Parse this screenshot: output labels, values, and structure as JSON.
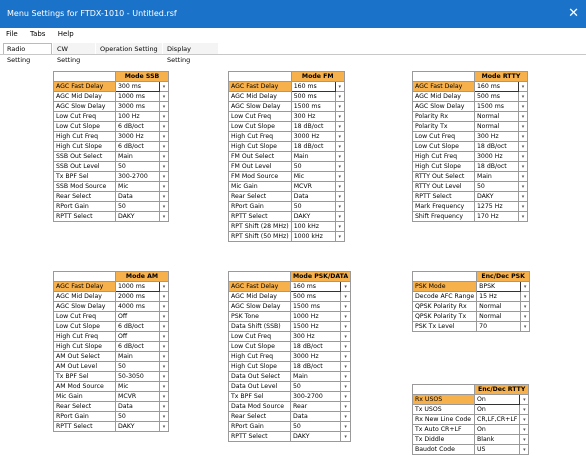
{
  "window": {
    "title": "Menu Settings for FTDX-1010 - Untitled.rsf",
    "close": "✕"
  },
  "menu": [
    "File",
    "Tabs",
    "Help"
  ],
  "tabs": [
    "Radio Setting",
    "CW Setting",
    "Operation Setting",
    "Display Setting"
  ],
  "panels": [
    {
      "id": "ssb",
      "header": "Mode SSB",
      "rows": [
        [
          "AGC Fast Delay",
          "300 ms"
        ],
        [
          "AGC Mid Delay",
          "1000 ms"
        ],
        [
          "AGC Slow Delay",
          "3000 ms"
        ],
        [
          "Low Cut Freq",
          "100 Hz"
        ],
        [
          "Low Cut Slope",
          "6 dB/oct"
        ],
        [
          "High Cut Freq",
          "3000 Hz"
        ],
        [
          "High Cut Slope",
          "6 dB/oct"
        ],
        [
          "SSB Out Select",
          "Main"
        ],
        [
          "SSB Out Level",
          "50"
        ],
        [
          "Tx BPF Sel",
          "300-2700"
        ],
        [
          "SSB Mod Source",
          "Mic"
        ],
        [
          "Rear Select",
          "Data"
        ],
        [
          "RPort Gain",
          "50"
        ],
        [
          "RPTT Select",
          "DAKY"
        ]
      ]
    },
    {
      "id": "fm",
      "header": "Mode FM",
      "rows": [
        [
          "AGC Fast Delay",
          "160 ms"
        ],
        [
          "AGC Mid Delay",
          "500 ms"
        ],
        [
          "AGC Slow Delay",
          "1500 ms"
        ],
        [
          "Low Cut Freq",
          "300 Hz"
        ],
        [
          "Low Cut Slope",
          "18 dB/oct"
        ],
        [
          "High Cut Freq",
          "3000 Hz"
        ],
        [
          "High Cut Slope",
          "18 dB/oct"
        ],
        [
          "FM Out Select",
          "Main"
        ],
        [
          "FM Out Level",
          "50"
        ],
        [
          "FM Mod Source",
          "Mic"
        ],
        [
          "Mic Gain",
          "MCVR"
        ],
        [
          "Rear Select",
          "Data"
        ],
        [
          "RPort Gain",
          "50"
        ],
        [
          "RPTT Select",
          "DAKY"
        ],
        [
          "RPT Shift (28 MHz)",
          "100 kHz"
        ],
        [
          "RPT Shift (50 MHz)",
          "1000 kHz"
        ]
      ]
    },
    {
      "id": "rtty",
      "header": "Mode RTTY",
      "rows": [
        [
          "AGC Fast Delay",
          "160 ms"
        ],
        [
          "AGC Mid Delay",
          "500 ms"
        ],
        [
          "AGC Slow Delay",
          "1500 ms"
        ],
        [
          "Polarity Rx",
          "Normal"
        ],
        [
          "Polarity Tx",
          "Normal"
        ],
        [
          "Low Cut Freq",
          "300 Hz"
        ],
        [
          "Low Cut Slope",
          "18 dB/oct"
        ],
        [
          "High Cut Freq",
          "3000 Hz"
        ],
        [
          "High Cut Slope",
          "18 dB/oct"
        ],
        [
          "RTTY Out Select",
          "Main"
        ],
        [
          "RTTY Out Level",
          "50"
        ],
        [
          "RPTT Select",
          "DAKY"
        ],
        [
          "Mark Frequency",
          "1275 Hz"
        ],
        [
          "Shift Frequency",
          "170 Hz"
        ]
      ]
    },
    {
      "id": "am",
      "header": "Mode AM",
      "rows": [
        [
          "AGC Fast Delay",
          "1000 ms"
        ],
        [
          "AGC Mid Delay",
          "2000 ms"
        ],
        [
          "AGC Slow Delay",
          "4000 ms"
        ],
        [
          "Low Cut Freq",
          "Off"
        ],
        [
          "Low Cut Slope",
          "6 dB/oct"
        ],
        [
          "High Cut Freq",
          "Off"
        ],
        [
          "High Cut Slope",
          "6 dB/oct"
        ],
        [
          "AM Out Select",
          "Main"
        ],
        [
          "AM Out Level",
          "50"
        ],
        [
          "Tx BPF Sel",
          "50-3050"
        ],
        [
          "AM Mod Source",
          "Mic"
        ],
        [
          "Mic Gain",
          "MCVR"
        ],
        [
          "Rear Select",
          "Data"
        ],
        [
          "RPort Gain",
          "50"
        ],
        [
          "RPTT Select",
          "DAKY"
        ]
      ]
    },
    {
      "id": "psk",
      "header": "Mode PSK/DATA",
      "rows": [
        [
          "AGC Fast Delay",
          "160 ms"
        ],
        [
          "AGC Mid Delay",
          "500 ms"
        ],
        [
          "AGC Slow Delay",
          "1500 ms"
        ],
        [
          "PSK Tone",
          "1000 Hz"
        ],
        [
          "Data Shift (SSB)",
          "1500 Hz"
        ],
        [
          "Low Cut Freq",
          "300 Hz"
        ],
        [
          "Low Cut Slope",
          "18 dB/oct"
        ],
        [
          "High Cut Freq",
          "3000 Hz"
        ],
        [
          "High Cut Slope",
          "18 dB/oct"
        ],
        [
          "Data Out Select",
          "Main"
        ],
        [
          "Data Out Level",
          "50"
        ],
        [
          "Tx BPF Sel",
          "300-2700"
        ],
        [
          "Data Mod Source",
          "Rear"
        ],
        [
          "Rear Select",
          "Data"
        ],
        [
          "RPort Gain",
          "50"
        ],
        [
          "RPTT Select",
          "DAKY"
        ]
      ]
    },
    {
      "id": "encpsk",
      "header": "Enc/Dec PSK",
      "rows": [
        [
          "PSK Mode",
          "BPSK"
        ],
        [
          "Decode AFC Range",
          "15 Hz"
        ],
        [
          "QPSK Polarity Rx",
          "Normal"
        ],
        [
          "QPSK Polarity Tx",
          "Normal"
        ],
        [
          "PSK Tx Level",
          "70"
        ]
      ]
    },
    {
      "id": "encrtty",
      "header": "Enc/Dec RTTY",
      "rows": [
        [
          "Rx USOS",
          "On"
        ],
        [
          "Tx USOS",
          "On"
        ],
        [
          "Rx New Line Code",
          "CR,LF,CR+LF"
        ],
        [
          "Tx Auto CR+LF",
          "On"
        ],
        [
          "Tx Diddle",
          "Blank"
        ],
        [
          "Baudot Code",
          "US"
        ]
      ]
    }
  ]
}
